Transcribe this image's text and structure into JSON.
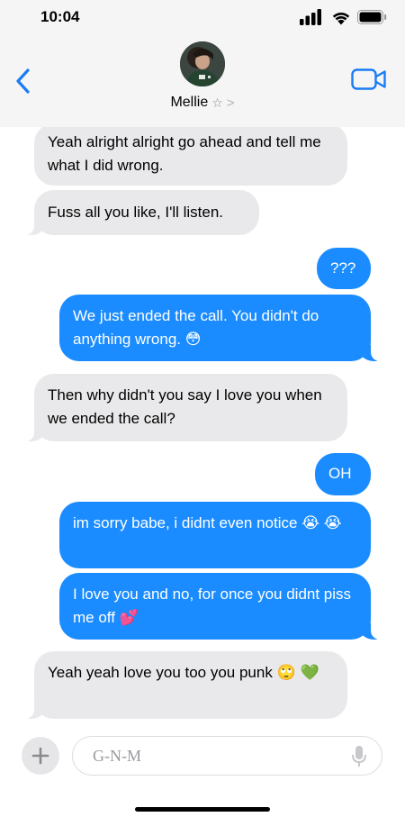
{
  "status_bar": {
    "time": "10:04"
  },
  "header": {
    "contact_name": "Mellie",
    "star_glyph": "☆",
    "chevron_glyph": ">",
    "back_icon": "chevron-left-icon",
    "video_icon": "video-camera-icon"
  },
  "messages": [
    {
      "dir": "in",
      "text": "Yeah alright alright go ahead and tell me what I did wrong."
    },
    {
      "dir": "in",
      "text": "Fuss all you like, I'll listen."
    },
    {
      "dir": "out",
      "text": "???"
    },
    {
      "dir": "out",
      "text": "We just ended the call. You didn't do anything wrong. 😳"
    },
    {
      "dir": "in",
      "text": "Then why didn't you say I love you when we ended the call?"
    },
    {
      "dir": "out",
      "text": "OH"
    },
    {
      "dir": "out",
      "text": "im sorry babe, i didnt even notice 😭 😭"
    },
    {
      "dir": "out",
      "text": "I love you and no, for once you didnt piss me off 💕"
    },
    {
      "dir": "in",
      "text": "Yeah yeah love you too you punk 🙄 💚"
    }
  ],
  "composer": {
    "placeholder": "G-N-M",
    "plus_icon": "plus-icon",
    "mic_icon": "microphone-icon"
  },
  "colors": {
    "outgoing_bubble": "#1a8cff",
    "incoming_bubble": "#e9e9eb",
    "accent": "#1a7cf5"
  }
}
